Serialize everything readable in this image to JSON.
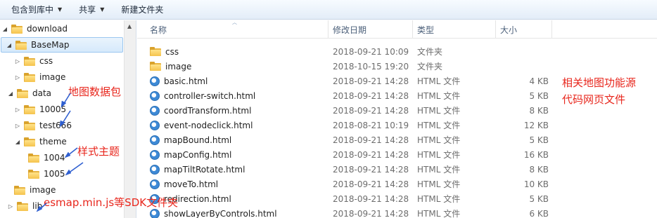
{
  "toolbar": {
    "include_library": "包含到库中",
    "share": "共享",
    "new_folder": "新建文件夹"
  },
  "tree": [
    {
      "label": "download",
      "expanded": true
    },
    {
      "label": "BaseMap",
      "expanded": true,
      "selected": true
    },
    {
      "label": "css",
      "expanded": false
    },
    {
      "label": "image",
      "expanded": false
    },
    {
      "label": "data",
      "expanded": true
    },
    {
      "label": "10005",
      "expanded": false
    },
    {
      "label": "test666",
      "expanded": false
    },
    {
      "label": "theme",
      "expanded": true
    },
    {
      "label": "1004"
    },
    {
      "label": "1005"
    },
    {
      "label": "image"
    },
    {
      "label": "lib",
      "expanded": false
    }
  ],
  "columns": {
    "name": "名称",
    "date": "修改日期",
    "type": "类型",
    "size": "大小"
  },
  "files": [
    {
      "name": "css",
      "date": "2018-09-21 10:09",
      "type": "文件夹",
      "size": "",
      "icon": "folder-icon"
    },
    {
      "name": "image",
      "date": "2018-10-15 19:20",
      "type": "文件夹",
      "size": "",
      "icon": "folder-icon"
    },
    {
      "name": "basic.html",
      "date": "2018-09-21 14:28",
      "type": "HTML 文件",
      "size": "4 KB",
      "icon": "html-icon"
    },
    {
      "name": "controller-switch.html",
      "date": "2018-09-21 14:28",
      "type": "HTML 文件",
      "size": "5 KB",
      "icon": "html-icon"
    },
    {
      "name": "coordTransform.html",
      "date": "2018-09-21 14:28",
      "type": "HTML 文件",
      "size": "8 KB",
      "icon": "html-icon"
    },
    {
      "name": "event-nodeclick.html",
      "date": "2018-08-21 10:19",
      "type": "HTML 文件",
      "size": "12 KB",
      "icon": "html-icon"
    },
    {
      "name": "mapBound.html",
      "date": "2018-09-21 14:28",
      "type": "HTML 文件",
      "size": "5 KB",
      "icon": "html-icon"
    },
    {
      "name": "mapConfig.html",
      "date": "2018-09-21 14:28",
      "type": "HTML 文件",
      "size": "16 KB",
      "icon": "html-icon"
    },
    {
      "name": "mapTiltRotate.html",
      "date": "2018-09-21 14:28",
      "type": "HTML 文件",
      "size": "8 KB",
      "icon": "html-icon"
    },
    {
      "name": "moveTo.html",
      "date": "2018-09-21 14:28",
      "type": "HTML 文件",
      "size": "10 KB",
      "icon": "html-icon"
    },
    {
      "name": "redirection.html",
      "date": "2018-09-21 14:28",
      "type": "HTML 文件",
      "size": "5 KB",
      "icon": "html-icon"
    },
    {
      "name": "showLayerByControls.html",
      "date": "2018-09-21 14:28",
      "type": "HTML 文件",
      "size": "6 KB",
      "icon": "html-icon"
    }
  ],
  "annotations": {
    "data_pack": "地图数据包",
    "style_theme": "样式主题",
    "sdk_folder": "esmap.min.js等SDK文件夹",
    "source_line1": "相关地图功能源",
    "source_line2": "代码网页文件"
  },
  "colors": {
    "annotation": "#e8261c",
    "arrow": "#2f5fd0",
    "selection": "#d6e9fb"
  }
}
